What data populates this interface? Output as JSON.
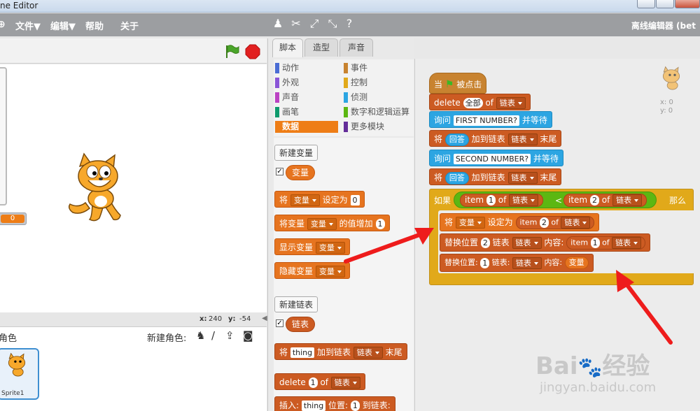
{
  "window": {
    "title": "ne Editor"
  },
  "menu": {
    "file": "文件▼",
    "edit": "编辑▼",
    "help": "帮助",
    "about": "关于",
    "mode": "离线编辑器 (bet"
  },
  "tabs": {
    "scripts": "脚本",
    "costumes": "造型",
    "sounds": "声音"
  },
  "categories": [
    {
      "label": "动作",
      "color": "#4a6cd4"
    },
    {
      "label": "外观",
      "color": "#8a55d7"
    },
    {
      "label": "声音",
      "color": "#bb42c3"
    },
    {
      "label": "画笔",
      "color": "#0e9a6c"
    },
    {
      "label": "数据",
      "color": "#ee7d16"
    },
    {
      "label": "事件",
      "color": "#c88330"
    },
    {
      "label": "控制",
      "color": "#e1a91a"
    },
    {
      "label": "侦测",
      "color": "#2ca5e2"
    },
    {
      "label": "数字和逻辑运算",
      "color": "#5cb712"
    },
    {
      "label": "更多模块",
      "color": "#632d99"
    }
  ],
  "palette": {
    "new_var": "新建变量",
    "var_name": "变量",
    "set_to": "将",
    "set_label": "设定为",
    "set_val": "0",
    "change_pre": "将变量",
    "change_label": "的值增加",
    "change_val": "1",
    "show_var": "显示变量",
    "hide_var": "隐藏变量",
    "new_list": "新建链表",
    "list_name": "链表",
    "add_pre": "将",
    "add_item": "thing",
    "add_label": "加到链表",
    "add_end": "末尾",
    "delete": "delete",
    "del_num": "1",
    "of": "of",
    "insert": "插入:",
    "insert_item": "thing",
    "pos": "位置:",
    "to_list": "到链表:"
  },
  "stage": {
    "coords_x_label": "x:",
    "coords_x": "240",
    "coords_y_label": "y:",
    "coords_y": "-54",
    "var_monitor": "0"
  },
  "sprites": {
    "header": "角色",
    "new_sprite": "新建角色:",
    "sprite1": "Sprite1"
  },
  "script": {
    "when": "当",
    "clicked": "被点击",
    "delete": "delete",
    "all": "全部",
    "of": "of",
    "list": "链表",
    "ask": "询问",
    "q1": "FIRST NUMBER?",
    "wait": "并等待",
    "add": "将",
    "answer": "回答",
    "add_to": "加到链表",
    "end": "末尾",
    "q2": "SECOND NUMBER?",
    "if": "如果",
    "item": "item",
    "n1": "1",
    "n2": "2",
    "lt": "<",
    "then": "那么",
    "set": "将",
    "var": "变量",
    "set_to": "设定为",
    "replace": "替换位置",
    "content": "内容:",
    "replace2": "替换位置:",
    "list_colon": "链表:",
    "sprite_x": "x: 0",
    "sprite_y": "y: 0"
  },
  "watermark": {
    "text1": "Bai",
    "text2": "经验",
    "url": "jingyan.baidu.com"
  }
}
